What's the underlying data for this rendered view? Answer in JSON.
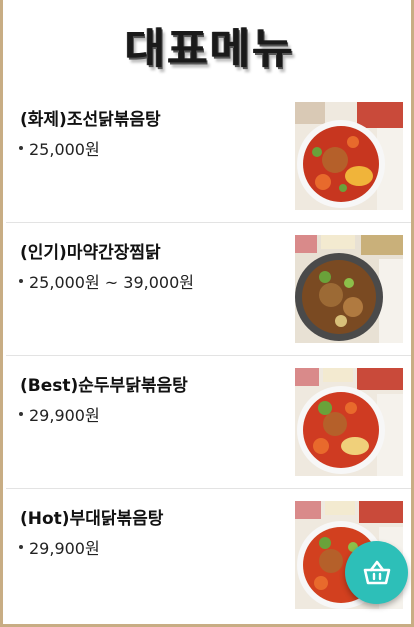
{
  "header": {
    "title": "대표메뉴"
  },
  "menu": {
    "items": [
      {
        "name": "(화제)조선닭볶음탕",
        "price": "25,000원",
        "image_icon": "dish-photo"
      },
      {
        "name": "(인기)마약간장찜닭",
        "price": "25,000원 ~ 39,000원",
        "image_icon": "dish-photo"
      },
      {
        "name": "(Best)순두부닭볶음탕",
        "price": "29,900원",
        "image_icon": "dish-photo"
      },
      {
        "name": "(Hot)부대닭볶음탕",
        "price": "29,900원",
        "image_icon": "dish-photo"
      }
    ]
  },
  "cart_button": {
    "icon": "basket-icon",
    "color": "#2dbfb8"
  },
  "colors": {
    "frame_border": "#c8ad84",
    "text": "#111111"
  }
}
